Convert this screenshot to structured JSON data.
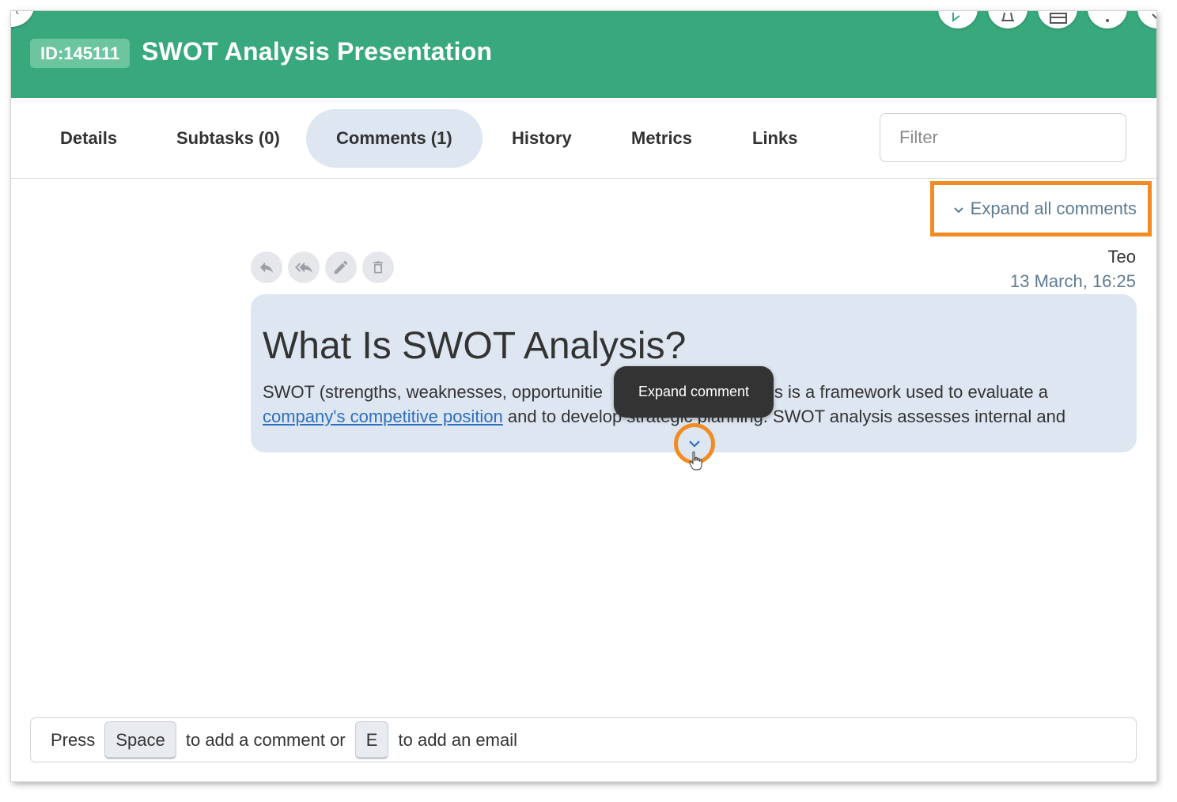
{
  "header": {
    "id_label": "ID:145111",
    "title": "SWOT Analysis Presentation",
    "bg_color": "#38a97d",
    "actions": [
      "tag-icon",
      "bell-icon",
      "layout-icon",
      "more-icon",
      "close-icon"
    ]
  },
  "tabs": [
    {
      "label": "Details",
      "active": false
    },
    {
      "label": "Subtasks (0)",
      "active": false
    },
    {
      "label": "Comments (1)",
      "active": true
    },
    {
      "label": "History",
      "active": false
    },
    {
      "label": "Metrics",
      "active": false
    },
    {
      "label": "Links",
      "active": false
    }
  ],
  "filter": {
    "placeholder": "Filter",
    "value": ""
  },
  "expand_all_label": "Expand all comments",
  "comment": {
    "author": "Teo",
    "timestamp": "13 March, 16:25",
    "actions": [
      "reply-icon",
      "reply-all-icon",
      "edit-icon",
      "delete-icon"
    ],
    "heading": "What Is SWOT Analysis?",
    "line1": "SWOT (strengths, weaknesses, opportunitie",
    "line1_tail": "sis is a framework used to evaluate a",
    "link_text": "company's competitive position",
    "line2_rest": " and to develop strategic planning. SWOT analysis assesses internal and"
  },
  "tooltip": "Expand comment",
  "hint": {
    "press": "Press ",
    "key1": "Space",
    "mid": " to add a comment or ",
    "key2": "E",
    "end": " to add an email"
  },
  "highlight_color": "#f28c22"
}
